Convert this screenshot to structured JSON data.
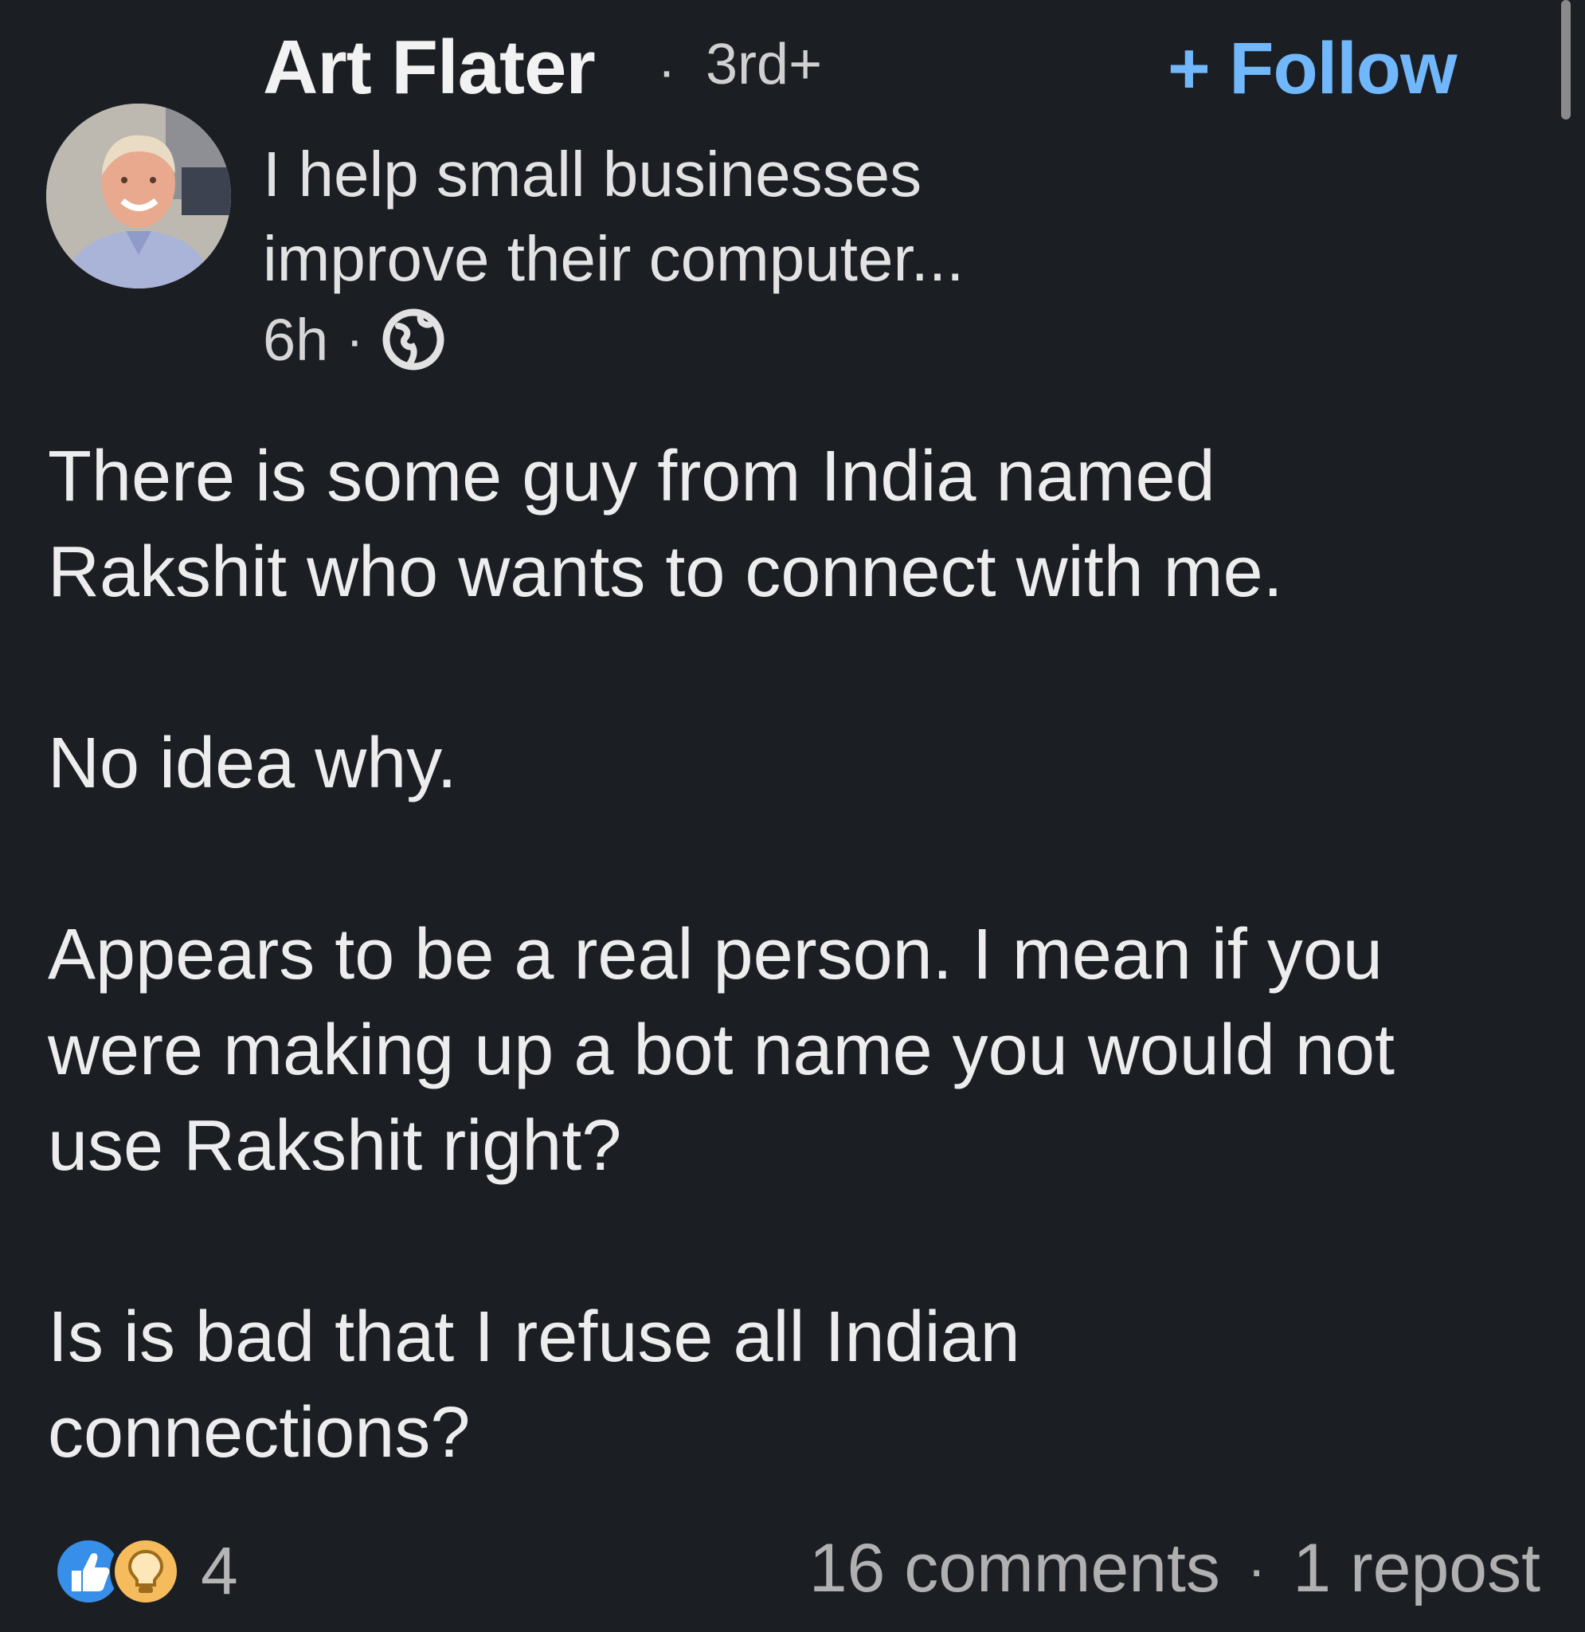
{
  "post": {
    "author": {
      "name": "Art Flater",
      "separator": "·",
      "degree": "3rd+",
      "headline_lines": [
        "I help small businesses",
        "improve their computer..."
      ]
    },
    "follow_label": "+ Follow",
    "time": "6h",
    "time_separator": "·",
    "visibility_icon": "globe-icon",
    "body_paragraphs": [
      [
        "There is some guy from India named",
        "Rakshit who wants to connect with me."
      ],
      [
        "No idea why."
      ],
      [
        "Appears to be a real person. I mean if you",
        "were making up a bot name you would not",
        "use Rakshit right?"
      ],
      [
        "Is is bad that I refuse all Indian",
        "connections?"
      ]
    ],
    "reactions": {
      "icons": [
        "like-icon",
        "insightful-icon"
      ],
      "count": "4"
    },
    "comments": "16 comments",
    "stats_separator": "·",
    "reposts": "1 repost"
  },
  "colors": {
    "background": "#1b1f23",
    "accent": "#71b7fb",
    "like": "#378fe9",
    "insightful": "#f5bb5c"
  }
}
